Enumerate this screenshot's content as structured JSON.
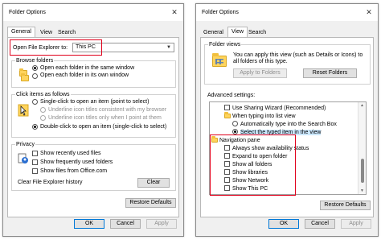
{
  "left_dialog": {
    "title": "Folder Options",
    "tabs": [
      "General",
      "View",
      "Search"
    ],
    "open_explorer_label": "Open File Explorer to:",
    "open_explorer_value": "This PC",
    "browse_folders": {
      "title": "Browse folders",
      "option1": "Open each folder in the same window",
      "option2": "Open each folder in its own window"
    },
    "click_items": {
      "title": "Click items as follows",
      "option1": "Single-click to open an item (point to select)",
      "sub1": "Underline icon titles consistent with my browser",
      "sub2": "Underline icon titles only when I point at them",
      "option2": "Double-click to open an item (single-click to select)"
    },
    "privacy": {
      "title": "Privacy",
      "item1": "Show recently used files",
      "item2": "Show frequently used folders",
      "item3": "Show files from Office.com",
      "clear_label": "Clear File Explorer history",
      "clear_button": "Clear"
    },
    "restore_defaults": "Restore Defaults",
    "ok": "OK",
    "cancel": "Cancel",
    "apply": "Apply"
  },
  "right_dialog": {
    "title": "Folder Options",
    "tabs": [
      "General",
      "View",
      "Search"
    ],
    "folder_views": {
      "title": "Folder views",
      "description_line1": "You can apply this view (such as Details or Icons) to",
      "description_line2": "all folders of this type.",
      "apply_button": "Apply to Folders",
      "reset_button": "Reset Folders"
    },
    "advanced_settings": {
      "title": "Advanced settings:",
      "items": [
        "Use Sharing Wizard (Recommended)",
        "When typing into list view",
        "Automatically type into the Search Box",
        "Select the typed item in the view",
        "Navigation pane",
        "Always show availability status",
        "Expand to open folder",
        "Show all folders",
        "Show libraries",
        "Show Network",
        "Show This PC"
      ]
    },
    "restore_defaults": "Restore Defaults",
    "ok": "OK",
    "cancel": "Cancel",
    "apply": "Apply"
  },
  "colors": {
    "highlight_red": "#e0001b",
    "accent_blue": "#0078d7",
    "dialog_bg": "#f0f0f0"
  },
  "icons": [
    "close-icon",
    "folder-icon",
    "mouse-pointer-icon",
    "privacy-icon",
    "chevron-down-icon"
  ]
}
